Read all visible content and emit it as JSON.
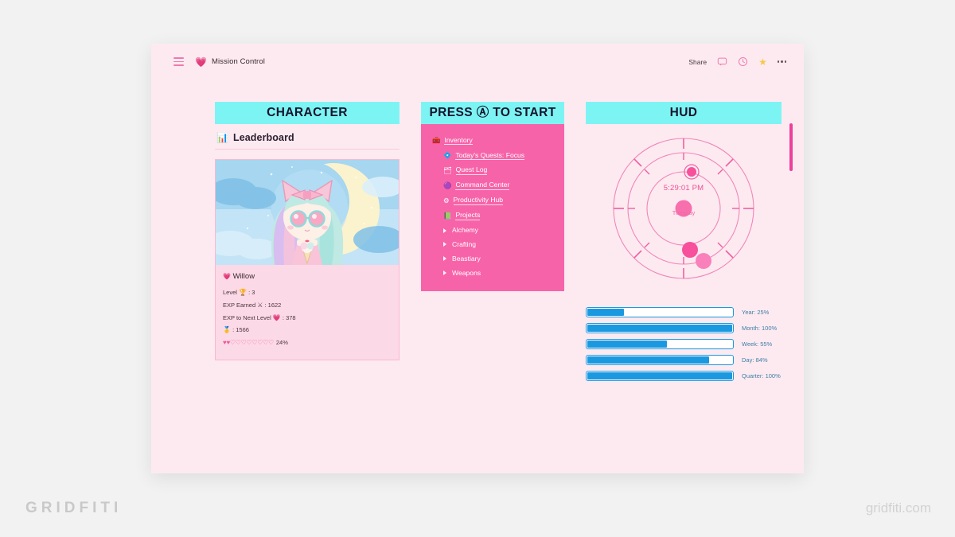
{
  "topbar": {
    "menu_icon": "hamburger-icon",
    "breadcrumb_icon": "heart-icon",
    "breadcrumb_heart": "💗",
    "breadcrumb_title": "Mission Control",
    "share_label": "Share",
    "comment_icon": "comment-icon",
    "history_icon": "clock-history-icon",
    "favorite_icon": "star-icon",
    "favorite_glyph": "★",
    "more_icon": "more-options-icon"
  },
  "character": {
    "banner": "CHARACTER",
    "leaderboard_icon": "📊",
    "leaderboard_label": "Leaderboard",
    "avatar_alt": "chibi-anime-girl-avatar",
    "name_icon": "💗",
    "name": "Willow",
    "stats": [
      {
        "label": "Level",
        "icon": "🏆",
        "value": "3"
      },
      {
        "label": "EXP Earned",
        "icon": "⚔",
        "value": "1622"
      },
      {
        "label": "EXP to Next Level",
        "icon": "💗",
        "value": "378"
      },
      {
        "label": "",
        "icon": "🥇",
        "value": "1566"
      }
    ],
    "progress_hearts": "♥♥♡♡♡♡♡♡♡♡",
    "progress_pct": "24%"
  },
  "press_start": {
    "banner": "PRESS Ⓐ TO START",
    "items": [
      {
        "label": "Inventory",
        "icon": "🧰",
        "level": 1,
        "type": "link"
      },
      {
        "label": "Today's Quests: Focus",
        "icon": "💠",
        "level": 2,
        "type": "link"
      },
      {
        "label": "Quest Log",
        "icon": "🗂",
        "level": 2,
        "type": "link"
      },
      {
        "label": "Command Center",
        "icon": "🟣",
        "level": 2,
        "type": "link"
      },
      {
        "label": "Productivity Hub",
        "icon": "⚙",
        "level": 2,
        "type": "link"
      },
      {
        "label": "Projects",
        "icon": "📗",
        "level": 2,
        "type": "link"
      },
      {
        "label": "Alchemy",
        "icon": "",
        "level": 2,
        "type": "toggle"
      },
      {
        "label": "Crafting",
        "icon": "",
        "level": 2,
        "type": "toggle"
      },
      {
        "label": "Beastiary",
        "icon": "",
        "level": 2,
        "type": "toggle"
      },
      {
        "label": "Weapons",
        "icon": "",
        "level": 2,
        "type": "toggle"
      }
    ]
  },
  "hud": {
    "banner": "HUD",
    "clock": {
      "time": "5:29:01 PM",
      "day": "Tuesday"
    },
    "progress_bars": [
      {
        "name": "Year",
        "label": "Year: 25%",
        "percent": 25
      },
      {
        "name": "Month",
        "label": "Month: 100%",
        "percent": 100
      },
      {
        "name": "Week",
        "label": "Week: 55%",
        "percent": 55
      },
      {
        "name": "Day",
        "label": "Day: 84%",
        "percent": 84
      },
      {
        "name": "Quarter",
        "label": "Quarter: 100%",
        "percent": 100
      }
    ]
  },
  "branding": {
    "left": "GRIDFITI",
    "right": "gridfiti.com"
  },
  "colors": {
    "page_bg": "#fdeaf0",
    "banner": "#7df4f4",
    "nav_panel": "#f763a9",
    "accent_pink": "#ef4f95",
    "bar_blue": "#1a98e0",
    "card_bg": "#fcd9e6"
  }
}
